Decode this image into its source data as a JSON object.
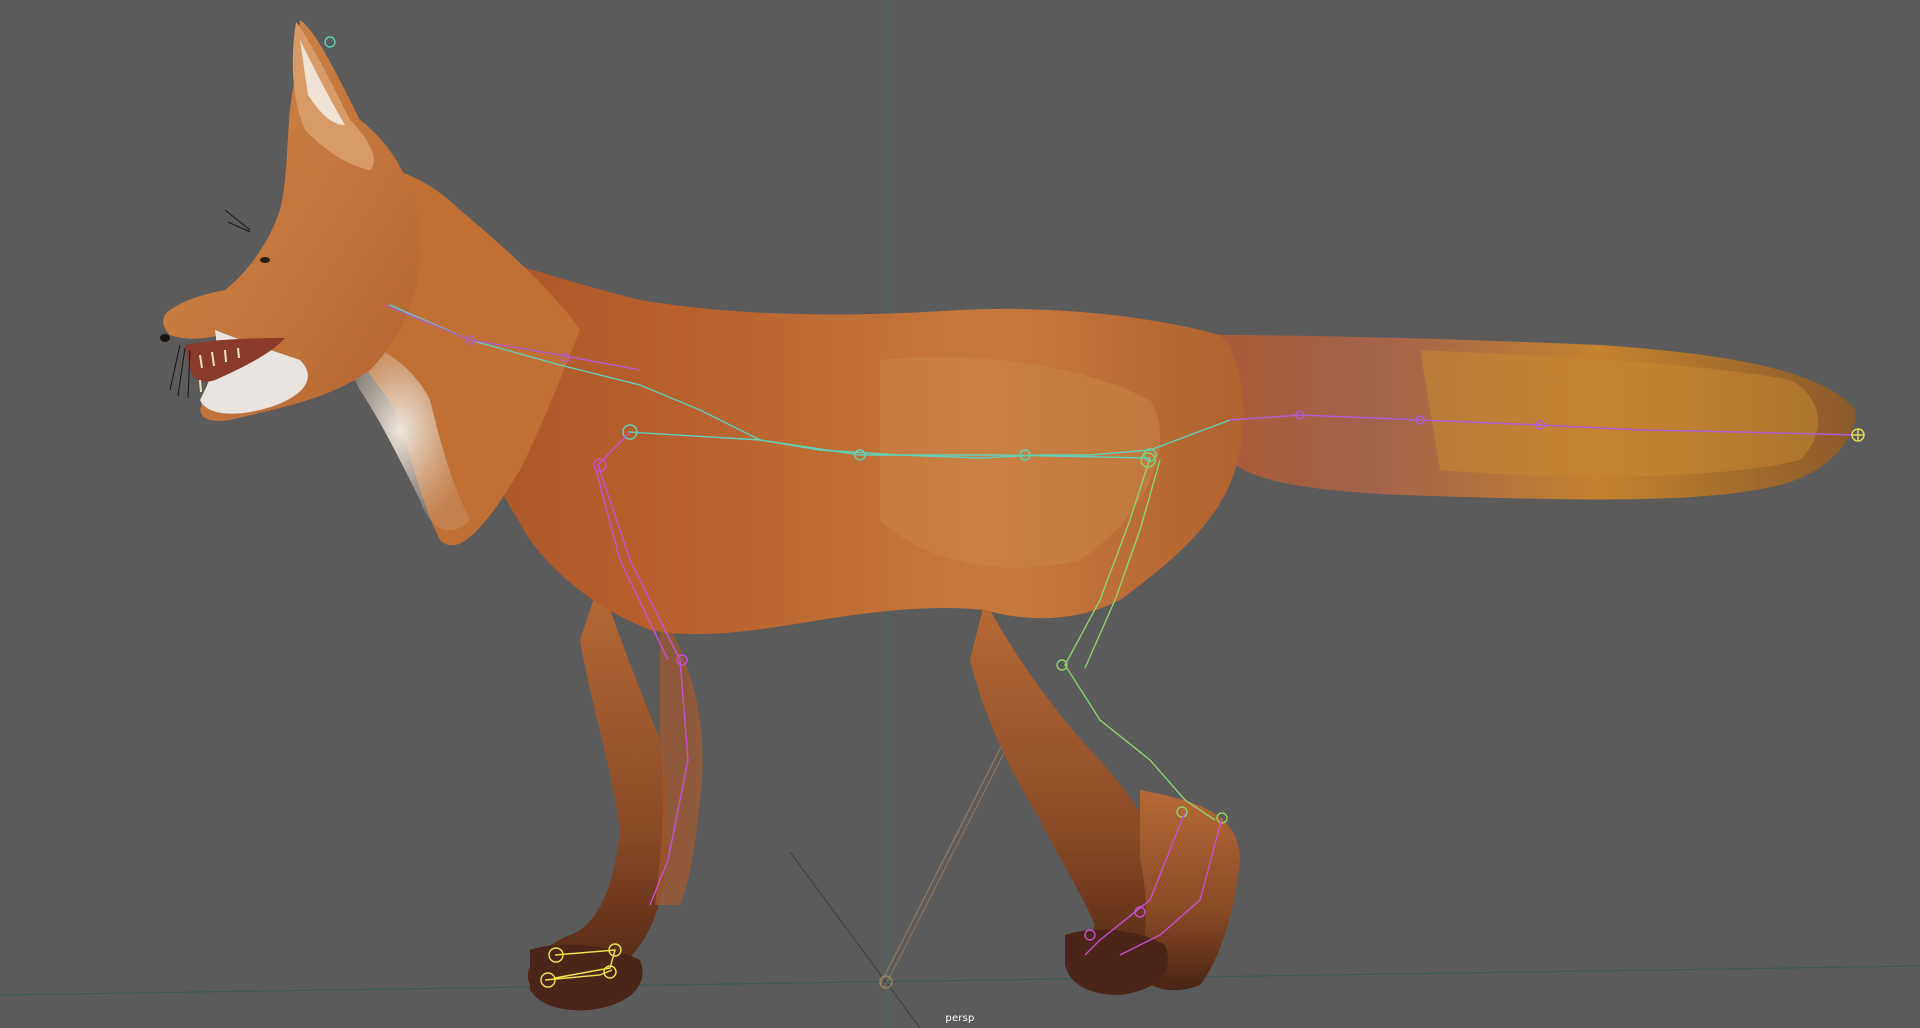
{
  "viewport": {
    "camera_label": "persp",
    "background_color": "#5b5b5b",
    "grid_color": "#3c6f6a",
    "model": "fox-rig",
    "joint_colors": {
      "spine": "#4fd7b8",
      "front_leg": "#c94fd1",
      "hind_leg": "#8bd36a",
      "feet": "#f0e84a",
      "tail": "#b05cd6"
    }
  }
}
